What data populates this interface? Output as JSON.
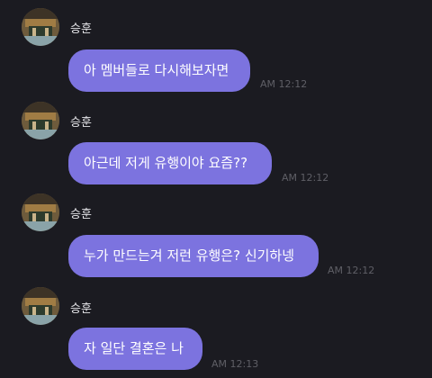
{
  "messages": [
    {
      "sender": "승훈",
      "text": "아 멤버들로 다시해보자면",
      "time": "AM 12:12",
      "avatar_icon": "profile-photo-icon"
    },
    {
      "sender": "승훈",
      "text": "아근데 저게 유행이야 요즘??",
      "time": "AM 12:12",
      "avatar_icon": "profile-photo-icon"
    },
    {
      "sender": "승훈",
      "text": "누가 만드는겨 저런 유행은? 신기하넹",
      "time": "AM 12:12",
      "avatar_icon": "profile-photo-icon"
    },
    {
      "sender": "승훈",
      "text": "자 일단 결혼은 나",
      "time": "AM 12:13",
      "avatar_icon": "profile-photo-icon"
    }
  ],
  "colors": {
    "background": "#1b1b21",
    "bubble": "#7c73df",
    "sender_text": "#e6e6ea",
    "timestamp_text": "#5f5f66"
  }
}
